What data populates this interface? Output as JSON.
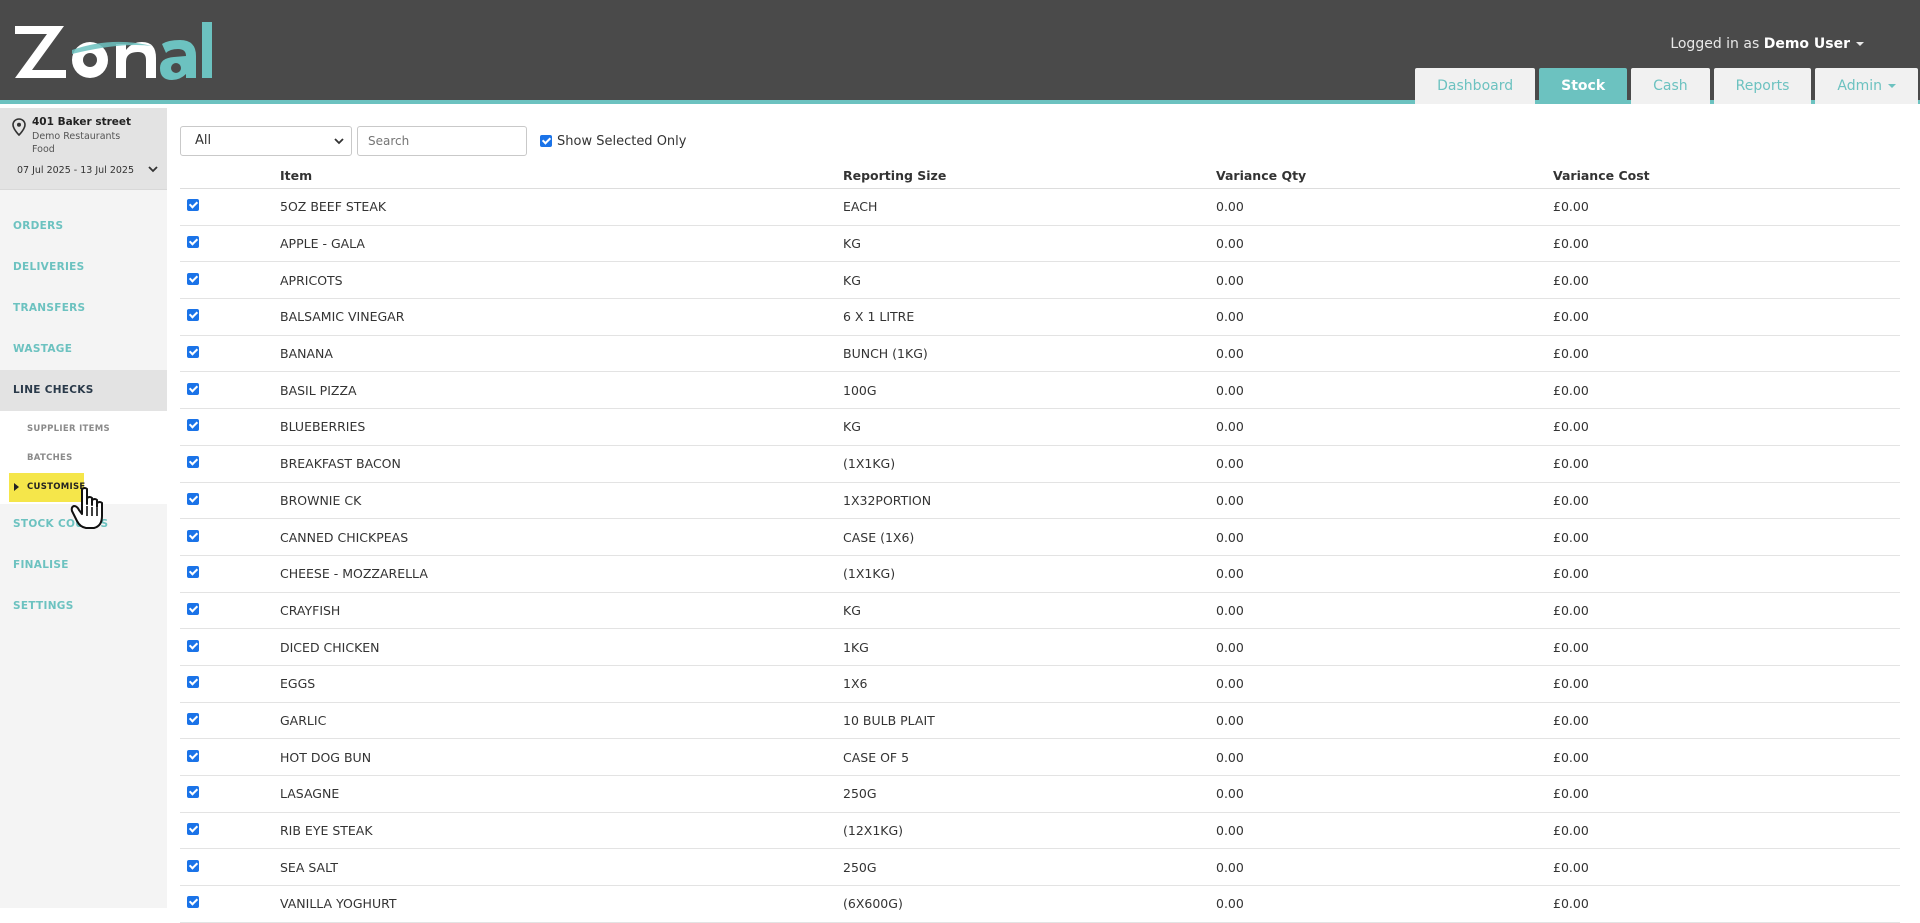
{
  "header": {
    "logo_text": "Zonal",
    "logged_in_prefix": "Logged in as",
    "user_name": "Demo User",
    "tabs": [
      {
        "label": "Dashboard",
        "active": false
      },
      {
        "label": "Stock",
        "active": true
      },
      {
        "label": "Cash",
        "active": false
      },
      {
        "label": "Reports",
        "active": false
      },
      {
        "label": "Admin",
        "active": false
      }
    ]
  },
  "sidebar": {
    "site_name": "401 Baker street",
    "site_org": "Demo Restaurants",
    "site_type": "Food",
    "date_range": "07 Jul 2025 - 13 Jul 2025",
    "items": [
      {
        "label": "ORDERS"
      },
      {
        "label": "DELIVERIES"
      },
      {
        "label": "TRANSFERS"
      },
      {
        "label": "WASTAGE"
      },
      {
        "label": "LINE CHECKS"
      },
      {
        "label": "STOCK COUNTS"
      },
      {
        "label": "FINALISE"
      },
      {
        "label": "SETTINGS"
      }
    ],
    "sub_items": [
      {
        "label": "SUPPLIER ITEMS"
      },
      {
        "label": "BATCHES"
      },
      {
        "label": "CUSTOMISE"
      }
    ]
  },
  "filters": {
    "select_value": "All",
    "search_placeholder": "Search",
    "show_selected_label": "Show Selected Only"
  },
  "table": {
    "headers": [
      "Item",
      "Reporting Size",
      "Variance Qty",
      "Variance Cost"
    ],
    "rows": [
      [
        "5OZ BEEF STEAK",
        "EACH",
        "0.00",
        "£0.00"
      ],
      [
        "APPLE - GALA",
        "KG",
        "0.00",
        "£0.00"
      ],
      [
        "APRICOTS",
        "KG",
        "0.00",
        "£0.00"
      ],
      [
        "BALSAMIC VINEGAR",
        "6 X 1 LITRE",
        "0.00",
        "£0.00"
      ],
      [
        "BANANA",
        "BUNCH (1KG)",
        "0.00",
        "£0.00"
      ],
      [
        "BASIL PIZZA",
        "100G",
        "0.00",
        "£0.00"
      ],
      [
        "BLUEBERRIES",
        "KG",
        "0.00",
        "£0.00"
      ],
      [
        "BREAKFAST BACON",
        "(1X1KG)",
        "0.00",
        "£0.00"
      ],
      [
        "BROWNIE CK",
        "1X32PORTION",
        "0.00",
        "£0.00"
      ],
      [
        "CANNED CHICKPEAS",
        "CASE (1X6)",
        "0.00",
        "£0.00"
      ],
      [
        "CHEESE - MOZZARELLA",
        "(1X1KG)",
        "0.00",
        "£0.00"
      ],
      [
        "CRAYFISH",
        "KG",
        "0.00",
        "£0.00"
      ],
      [
        "DICED CHICKEN",
        "1KG",
        "0.00",
        "£0.00"
      ],
      [
        "EGGS",
        "1X6",
        "0.00",
        "£0.00"
      ],
      [
        "GARLIC",
        "10 BULB PLAIT",
        "0.00",
        "£0.00"
      ],
      [
        "HOT DOG BUN",
        "CASE OF 5",
        "0.00",
        "£0.00"
      ],
      [
        "LASAGNE",
        "250G",
        "0.00",
        "£0.00"
      ],
      [
        "RIB EYE STEAK",
        "(12X1KG)",
        "0.00",
        "£0.00"
      ],
      [
        "SEA SALT",
        "250G",
        "0.00",
        "£0.00"
      ],
      [
        "VANILLA YOGHURT",
        "(6X600G)",
        "0.00",
        "£0.00"
      ]
    ]
  },
  "colors": {
    "header_bg": "#4a4a4a",
    "accent": "#6cc2c0",
    "highlight": "#f5e64a",
    "checkbox": "#1a73e8"
  }
}
